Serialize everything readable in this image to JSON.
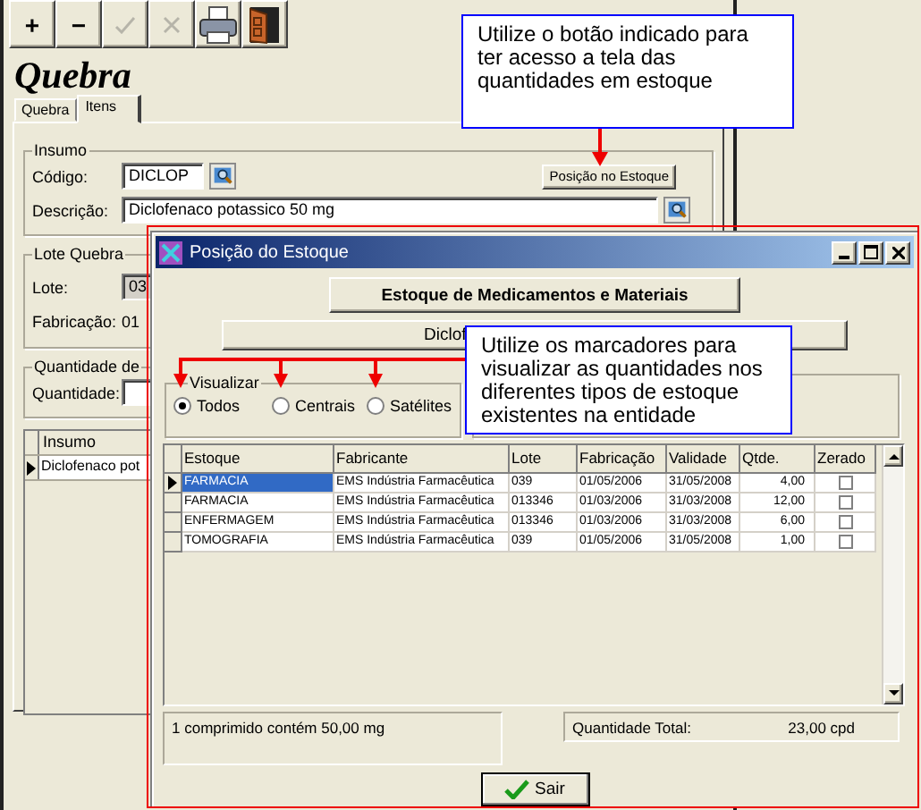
{
  "main_window": {
    "toolbar": [
      {
        "kind": "text",
        "label": "+",
        "disabled": false
      },
      {
        "kind": "text",
        "label": "−",
        "disabled": false
      },
      {
        "kind": "check",
        "disabled": true
      },
      {
        "kind": "cross",
        "disabled": true
      },
      {
        "kind": "printer",
        "disabled": false
      },
      {
        "kind": "door",
        "disabled": false
      }
    ],
    "title": "Quebra",
    "tabs": [
      {
        "label": "Quebra",
        "selected": false
      },
      {
        "label": "Itens",
        "selected": true
      }
    ],
    "insumo": {
      "legend": "Insumo",
      "code_label": "Código:",
      "code_value": "DICLOP",
      "stock_button": "Posição no Estoque",
      "description_label": "Descrição:",
      "description_value": "Diclofenaco potassico 50 mg"
    },
    "lote": {
      "legend": "Lote Quebra",
      "lote_label": "Lote:",
      "lote_value": "03",
      "fabricacao_label": "Fabricação:",
      "fabricacao_value": "01"
    },
    "quantidade": {
      "legend": "Quantidade de",
      "label": "Quantidade:"
    },
    "grid": {
      "columns": [
        "Insumo"
      ],
      "rows": [
        {
          "cells": [
            "Diclofenaco pot"
          ],
          "selected": true
        }
      ]
    }
  },
  "dialog": {
    "title": "Posição do Estoque",
    "header_button": "Estoque de Medicamentos e Materiais",
    "product_button": "Diclof",
    "filter": {
      "legend": "Visualizar",
      "options": [
        {
          "label": "Todos",
          "selected": true
        },
        {
          "label": "Centrais",
          "selected": false
        },
        {
          "label": "Satélites",
          "selected": false
        }
      ]
    },
    "table": {
      "columns": [
        "Estoque",
        "Fabricante",
        "Lote",
        "Fabricação",
        "Validade",
        "Qtde.",
        "Zerado"
      ],
      "rows": [
        {
          "cells": [
            "FARMACIA",
            "EMS Indústria Farmacêutica",
            "039",
            "01/05/2006",
            "31/05/2008",
            "4,00"
          ],
          "zerado": false,
          "selected": true
        },
        {
          "cells": [
            "FARMACIA",
            "EMS Indústria Farmacêutica",
            "013346",
            "01/03/2006",
            "31/03/2008",
            "12,00"
          ],
          "zerado": false,
          "selected": false
        },
        {
          "cells": [
            "ENFERMAGEM",
            "EMS Indústria Farmacêutica",
            "013346",
            "01/03/2006",
            "31/03/2008",
            "6,00"
          ],
          "zerado": false,
          "selected": false
        },
        {
          "cells": [
            "TOMOGRAFIA",
            "EMS Indústria Farmacêutica",
            "039",
            "01/05/2006",
            "31/05/2008",
            "1,00"
          ],
          "zerado": false,
          "selected": false
        }
      ]
    },
    "info": "1 comprimido contém 50,00 mg",
    "total_label": "Quantidade Total:",
    "total_value": "23,00 cpd",
    "exit_button": "Sair"
  },
  "callouts": [
    {
      "text": "Utilize o botão indicado para ter acesso a tela das quantidades em estoque"
    },
    {
      "text": "Utilize os marcadores para visualizar as quantidades nos diferentes tipos de estoque existentes na entidade"
    }
  ]
}
